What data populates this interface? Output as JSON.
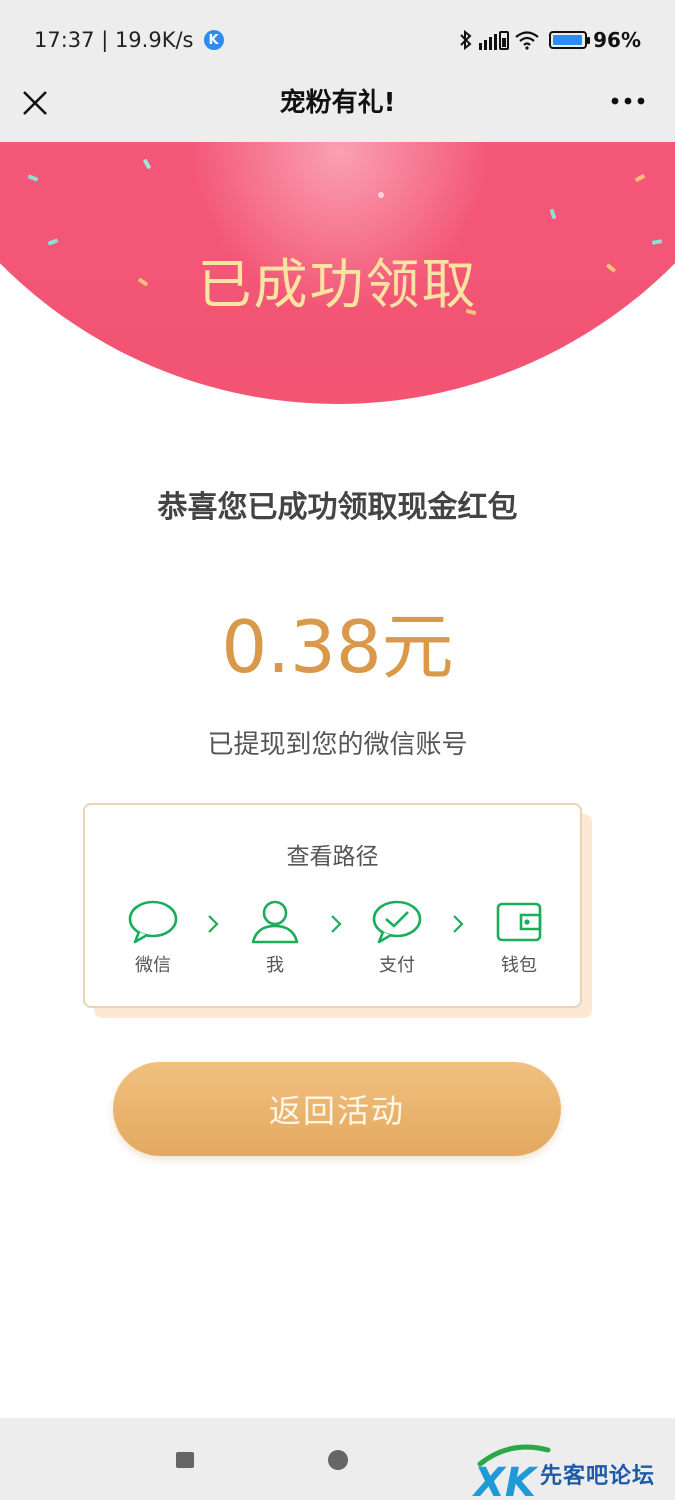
{
  "status_bar": {
    "time_speed": "17:37 | 19.9K/s",
    "k_badge": "K",
    "battery_percent": 96,
    "battery_text": "96%"
  },
  "nav": {
    "title": "宠粉有礼!"
  },
  "hero": {
    "title": "已成功领取"
  },
  "main": {
    "congrats": "恭喜您已成功领取现金红包",
    "amount": "0.38元",
    "withdrawn": "已提现到您的微信账号"
  },
  "path_card": {
    "title": "查看路径",
    "steps": [
      {
        "label": "微信",
        "icon": "chat-bubble-icon"
      },
      {
        "label": "我",
        "icon": "person-icon"
      },
      {
        "label": "支付",
        "icon": "pay-check-icon"
      },
      {
        "label": "钱包",
        "icon": "wallet-icon"
      }
    ]
  },
  "return_button": {
    "label": "返回活动"
  },
  "watermark": {
    "text": "先客吧论坛",
    "logo": "XK"
  },
  "colors": {
    "hero_pink": "#f4587a",
    "hero_title": "#fbe3a1",
    "amount": "#d9984a",
    "wechat_green": "#1aad5a",
    "button_gold": "#e8b26a"
  }
}
